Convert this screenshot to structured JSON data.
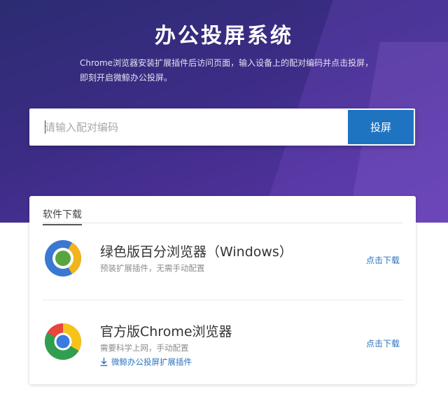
{
  "header": {
    "title": "办公投屏系统",
    "description": "Chrome浏览器安装扩展插件后访问页面，输入设备上的配对编码并点击投屏，即刻开启微鲸办公投屏。"
  },
  "search": {
    "placeholder": "请输入配对编码",
    "value": "",
    "button_label": "投屏"
  },
  "downloads": {
    "section_title": "软件下载",
    "items": [
      {
        "name": "绿色版百分浏览器（Windows）",
        "subtitle": "预装扩展插件，无需手动配置",
        "action_label": "点击下载",
        "icon": "centbrowser-icon"
      },
      {
        "name": "官方版Chrome浏览器",
        "subtitle": "需要科学上网，手动配置",
        "extra_link": "微鲸办公投屏扩展插件",
        "extra_icon": "download-icon",
        "action_label": "点击下载",
        "icon": "chrome-icon"
      }
    ]
  },
  "colors": {
    "hero_gradient_start": "#2b2c72",
    "hero_gradient_end": "#5a35a8",
    "accent_button": "#1f74c2",
    "link": "#2a73c0"
  }
}
